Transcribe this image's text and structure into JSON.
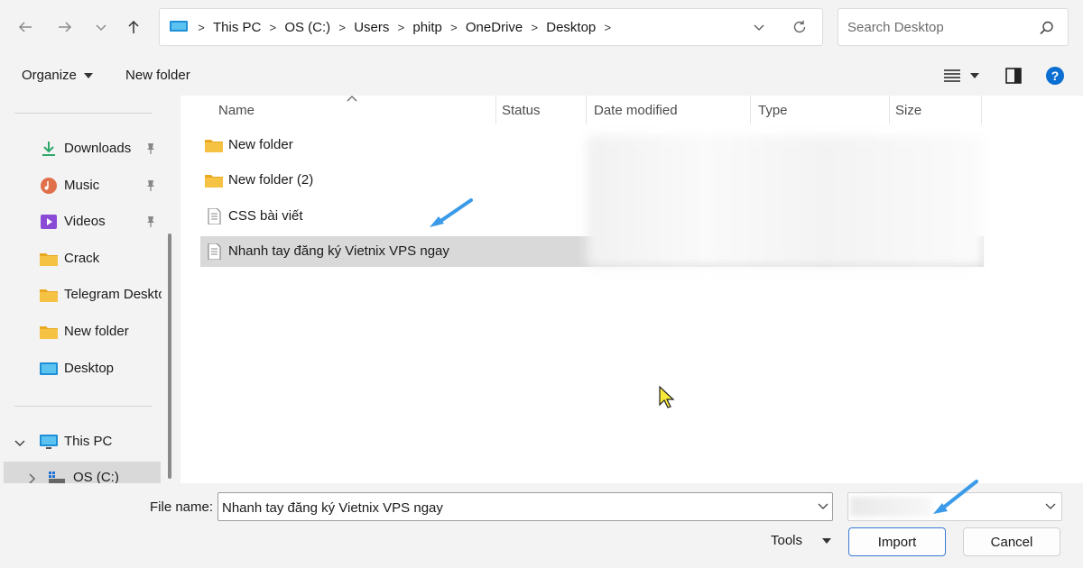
{
  "nav_buttons": [
    {
      "name": "back-button",
      "icon": "arrow-left-icon"
    },
    {
      "name": "forward-button",
      "icon": "arrow-right-icon"
    },
    {
      "name": "recent-dropdown-button",
      "icon": "chevron-down-icon"
    },
    {
      "name": "up-button",
      "icon": "arrow-up-icon"
    }
  ],
  "address_bar": {
    "breadcrumbs": [
      "This PC",
      "OS (C:)",
      "Users",
      "phitp",
      "OneDrive",
      "Desktop"
    ]
  },
  "search": {
    "placeholder": "Search Desktop"
  },
  "command_bar": {
    "organize_label": "Organize",
    "new_folder_label": "New folder"
  },
  "nav_pane": {
    "quick_access": [
      {
        "label": "Downloads",
        "icon": "download-icon",
        "pinned": true
      },
      {
        "label": "Music",
        "icon": "music-icon",
        "pinned": true
      },
      {
        "label": "Videos",
        "icon": "video-icon",
        "pinned": true
      },
      {
        "label": "Crack",
        "icon": "folder-icon",
        "pinned": false
      },
      {
        "label": "Telegram Desktop",
        "icon": "folder-icon",
        "pinned": false
      },
      {
        "label": "New folder",
        "icon": "folder-icon",
        "pinned": false
      },
      {
        "label": "Desktop",
        "icon": "desktop-icon",
        "pinned": false
      }
    ],
    "this_pc_label": "This PC",
    "drive_label": "OS (C:)"
  },
  "file_list": {
    "columns": [
      "Name",
      "Status",
      "Date modified",
      "Type",
      "Size"
    ],
    "rows": [
      {
        "name": "New folder",
        "icon": "folder-icon",
        "selected": false
      },
      {
        "name": "New folder (2)",
        "icon": "folder-icon",
        "selected": false
      },
      {
        "name": "CSS bài viết",
        "icon": "text-file-icon",
        "selected": false
      },
      {
        "name": "Nhanh tay đăng ký Vietnix VPS ngay",
        "icon": "text-file-icon",
        "selected": true
      }
    ]
  },
  "footer": {
    "file_name_label": "File name:",
    "file_name_value": "Nhanh tay đăng ký Vietnix VPS ngay",
    "tools_label": "Tools",
    "import_label": "Import",
    "cancel_label": "Cancel"
  },
  "colors": {
    "accent": "#0067c0",
    "annotation_arrow": "#3b9be8",
    "selection": "#d9d9d9",
    "folder": "#f6c244"
  }
}
